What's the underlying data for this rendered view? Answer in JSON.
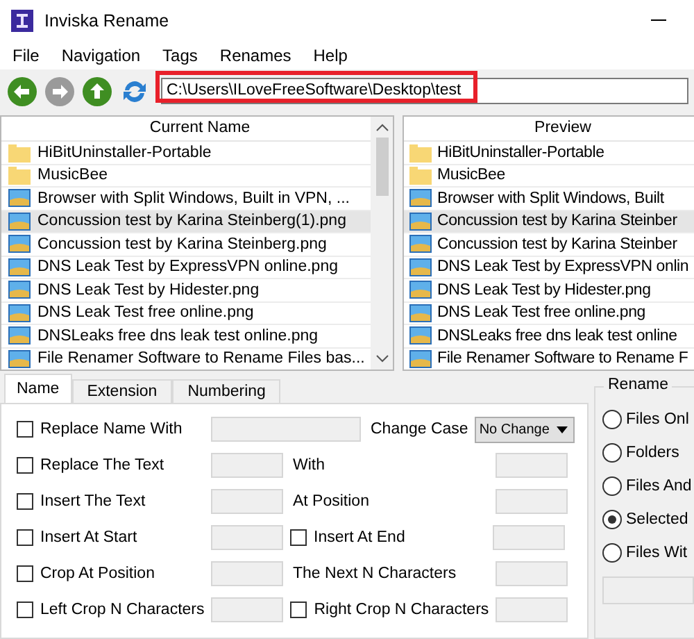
{
  "window": {
    "title": "Inviska Rename"
  },
  "menu": [
    {
      "label": "File"
    },
    {
      "label": "Navigation"
    },
    {
      "label": "Tags"
    },
    {
      "label": "Renames"
    },
    {
      "label": "Help"
    }
  ],
  "toolbar": {
    "buttons": [
      {
        "kind": "back",
        "disabled": false
      },
      {
        "kind": "forward",
        "disabled": true
      },
      {
        "kind": "up",
        "disabled": false
      },
      {
        "kind": "refresh",
        "disabled": false
      }
    ],
    "address": "C:\\Users\\ILoveFreeSoftware\\Desktop\\test"
  },
  "current_name": {
    "header": "Current Name",
    "rows": [
      {
        "name": "HiBitUninstaller-Portable",
        "kind": "folder",
        "selected": false
      },
      {
        "name": "MusicBee",
        "kind": "folder",
        "selected": false
      },
      {
        "name": "Browser with Split Windows, Built in VPN, ...",
        "kind": "image",
        "selected": false
      },
      {
        "name": "Concussion test by Karina Steinberg(1).png",
        "kind": "image",
        "selected": true
      },
      {
        "name": "Concussion test by Karina Steinberg.png",
        "kind": "image",
        "selected": false
      },
      {
        "name": "DNS Leak Test by ExpressVPN online.png",
        "kind": "image",
        "selected": false
      },
      {
        "name": "DNS Leak Test by Hidester.png",
        "kind": "image",
        "selected": false
      },
      {
        "name": "DNS Leak Test free online.png",
        "kind": "image",
        "selected": false
      },
      {
        "name": "DNSLeaks free dns leak test online.png",
        "kind": "image",
        "selected": false
      },
      {
        "name": "File Renamer Software to Rename Files bas...",
        "kind": "image",
        "selected": false
      }
    ]
  },
  "preview": {
    "header": "Preview",
    "rows": [
      {
        "name": "HiBitUninstaller-Portable",
        "kind": "folder",
        "selected": false
      },
      {
        "name": "MusicBee",
        "kind": "folder",
        "selected": false
      },
      {
        "name": "Browser with Split Windows, Built",
        "kind": "image",
        "selected": false
      },
      {
        "name": "Concussion test by Karina Steinber",
        "kind": "image",
        "selected": true
      },
      {
        "name": "Concussion test by Karina Steinber",
        "kind": "image",
        "selected": false
      },
      {
        "name": "DNS Leak Test by ExpressVPN onlin",
        "kind": "image",
        "selected": false
      },
      {
        "name": "DNS Leak Test by Hidester.png",
        "kind": "image",
        "selected": false
      },
      {
        "name": "DNS Leak Test free online.png",
        "kind": "image",
        "selected": false
      },
      {
        "name": "DNSLeaks free dns leak test online",
        "kind": "image",
        "selected": false
      },
      {
        "name": "File Renamer Software to Rename F",
        "kind": "image",
        "selected": false
      }
    ]
  },
  "tabs": [
    {
      "label": "Name",
      "selected": true
    },
    {
      "label": "Extension",
      "selected": false
    },
    {
      "label": "Numbering",
      "selected": false
    }
  ],
  "options": [
    {
      "label": "Replace Name With",
      "checked": false,
      "right": {
        "kind": "dropdown",
        "label": "Change Case",
        "value": "No Change"
      }
    },
    {
      "label": "Replace The Text",
      "checked": false,
      "right": {
        "kind": "text",
        "label": "With"
      }
    },
    {
      "label": "Insert The Text",
      "checked": false,
      "right": {
        "kind": "text",
        "label": "At Position"
      }
    },
    {
      "label": "Insert At Start",
      "checked": false,
      "right": {
        "kind": "checkbox",
        "label": "Insert At End",
        "checked": false
      }
    },
    {
      "label": "Crop At Position",
      "checked": false,
      "right": {
        "kind": "text",
        "label": "The Next N Characters"
      }
    },
    {
      "label": "Left Crop N Characters",
      "checked": false,
      "right": {
        "kind": "checkbox",
        "label": "Right Crop N Characters",
        "checked": false
      }
    }
  ],
  "rename": {
    "title": "Rename",
    "choices": [
      {
        "label": "Files Onl",
        "selected": false
      },
      {
        "label": "Folders",
        "selected": false
      },
      {
        "label": "Files And",
        "selected": false
      },
      {
        "label": "Selected",
        "selected": true
      },
      {
        "label": "Files Wit",
        "selected": false
      }
    ]
  }
}
